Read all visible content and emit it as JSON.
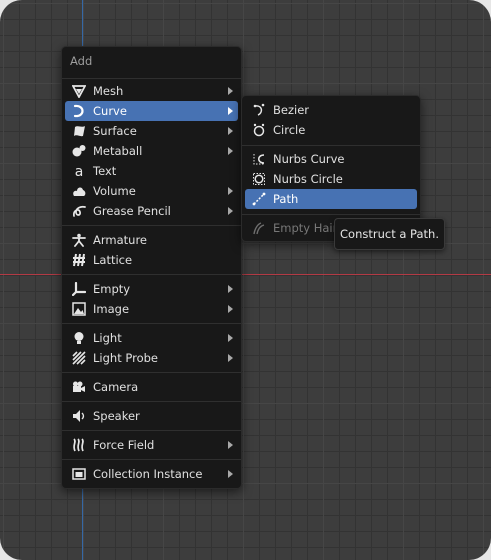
{
  "add_menu": {
    "title": "Add",
    "items": [
      {
        "label": "Mesh",
        "icon": "mesh-icon",
        "submenu": true
      },
      {
        "label": "Curve",
        "icon": "curve-icon",
        "submenu": true,
        "active": true
      },
      {
        "label": "Surface",
        "icon": "surface-icon",
        "submenu": true
      },
      {
        "label": "Metaball",
        "icon": "metaball-icon",
        "submenu": true
      },
      {
        "label": "Text",
        "icon": "text-icon",
        "submenu": false
      },
      {
        "label": "Volume",
        "icon": "volume-icon",
        "submenu": true
      },
      {
        "label": "Grease Pencil",
        "icon": "grease-pencil-icon",
        "submenu": true
      },
      {
        "label": "Armature",
        "icon": "armature-icon",
        "submenu": false
      },
      {
        "label": "Lattice",
        "icon": "lattice-icon",
        "submenu": false
      },
      {
        "label": "Empty",
        "icon": "empty-icon",
        "submenu": true
      },
      {
        "label": "Image",
        "icon": "image-icon",
        "submenu": true
      },
      {
        "label": "Light",
        "icon": "light-icon",
        "submenu": true
      },
      {
        "label": "Light Probe",
        "icon": "light-probe-icon",
        "submenu": true
      },
      {
        "label": "Camera",
        "icon": "camera-icon",
        "submenu": false
      },
      {
        "label": "Speaker",
        "icon": "speaker-icon",
        "submenu": false
      },
      {
        "label": "Force Field",
        "icon": "force-field-icon",
        "submenu": true
      },
      {
        "label": "Collection Instance",
        "icon": "collection-instance-icon",
        "submenu": true
      }
    ]
  },
  "curve_menu": {
    "items": [
      {
        "label": "Bezier",
        "icon": "bezier-icon"
      },
      {
        "label": "Circle",
        "icon": "circle-icon"
      },
      {
        "label": "Nurbs Curve",
        "icon": "nurbs-curve-icon"
      },
      {
        "label": "Nurbs Circle",
        "icon": "nurbs-circle-icon"
      },
      {
        "label": "Path",
        "icon": "path-icon",
        "active": true
      },
      {
        "label": "Empty Hair",
        "icon": "empty-hair-icon",
        "disabled": true
      }
    ]
  },
  "tooltip": {
    "text": "Construct a Path."
  },
  "colors": {
    "active_highlight": "#4772b3",
    "menu_bg": "#181818",
    "x_axis": "#b33a45",
    "y_axis": "#3568a6"
  }
}
